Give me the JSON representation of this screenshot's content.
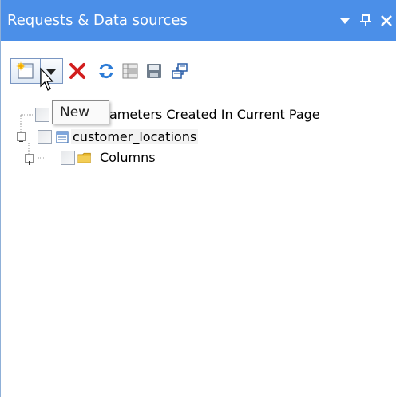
{
  "panel": {
    "title": "Requests & Data sources",
    "controls": {
      "dropdown": "chevron-down-icon",
      "pin": "pin-icon",
      "close": "close-icon"
    }
  },
  "toolbar": {
    "buttons": [
      {
        "name": "new",
        "icon": "new-item-icon"
      },
      {
        "name": "new-dropdown",
        "icon": "chevron-down-icon"
      },
      {
        "name": "delete",
        "icon": "delete-x-icon"
      },
      {
        "name": "refresh",
        "icon": "refresh-icon"
      },
      {
        "name": "grid",
        "icon": "grid-icon"
      },
      {
        "name": "save",
        "icon": "save-icon"
      },
      {
        "name": "link",
        "icon": "link-icon"
      }
    ]
  },
  "tooltip": {
    "text": "New"
  },
  "tree": {
    "nodes": [
      {
        "label": "ameters Created In Current Page",
        "icon": "none"
      },
      {
        "label": "customer_locations",
        "icon": "table-icon",
        "expanded": true
      },
      {
        "label": "Columns",
        "icon": "folder-icon",
        "expanded": false
      }
    ]
  },
  "colors": {
    "titlebar": "#4b8fe8",
    "delete": "#d21e1e",
    "refresh": "#2b7bd6",
    "folder": "#e7b52a"
  }
}
